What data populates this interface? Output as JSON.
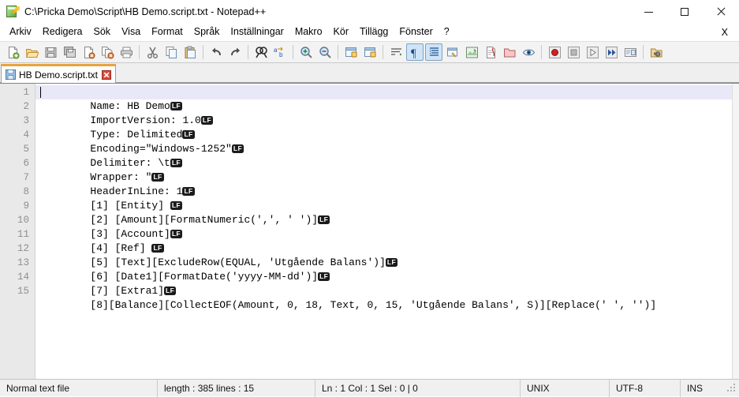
{
  "window": {
    "title": "C:\\Pricka Demo\\Script\\HB Demo.script.txt - Notepad++",
    "icon": "notepad-plus-plus-icon",
    "minimize_label": "",
    "maximize_label": "",
    "close_label": ""
  },
  "menubar": {
    "items": [
      {
        "label": "Arkiv"
      },
      {
        "label": "Redigera"
      },
      {
        "label": "Sök"
      },
      {
        "label": "Visa"
      },
      {
        "label": "Format"
      },
      {
        "label": "Språk"
      },
      {
        "label": "Inställningar"
      },
      {
        "label": "Makro"
      },
      {
        "label": "Kör"
      },
      {
        "label": "Tillägg"
      },
      {
        "label": "Fönster"
      },
      {
        "label": "?"
      }
    ],
    "close_document_label": "X"
  },
  "toolbar": {
    "buttons": [
      {
        "name": "new-file-icon",
        "title": "Nytt"
      },
      {
        "name": "open-file-icon",
        "title": "Öppna"
      },
      {
        "name": "save-icon",
        "title": "Spara"
      },
      {
        "name": "save-all-icon",
        "title": "Spara alla"
      },
      {
        "name": "close-file-icon",
        "title": "Stäng"
      },
      {
        "name": "close-all-files-icon",
        "title": "Stäng alla"
      },
      {
        "name": "print-icon",
        "title": "Skriv ut"
      },
      {
        "name": "separator-1",
        "title": ""
      },
      {
        "name": "cut-icon",
        "title": "Klipp ut"
      },
      {
        "name": "copy-icon",
        "title": "Kopiera"
      },
      {
        "name": "paste-icon",
        "title": "Klistra in"
      },
      {
        "name": "separator-2",
        "title": ""
      },
      {
        "name": "undo-icon",
        "title": "Ångra"
      },
      {
        "name": "redo-icon",
        "title": "Gör om"
      },
      {
        "name": "separator-3",
        "title": ""
      },
      {
        "name": "find-icon",
        "title": "Sök"
      },
      {
        "name": "replace-icon",
        "title": "Ersätt"
      },
      {
        "name": "separator-4",
        "title": ""
      },
      {
        "name": "zoom-in-icon",
        "title": "Zooma in"
      },
      {
        "name": "zoom-out-icon",
        "title": "Zooma ut"
      },
      {
        "name": "separator-5",
        "title": ""
      },
      {
        "name": "sync-vertical-scroll-icon",
        "title": "Synkronisera vertikal rullning"
      },
      {
        "name": "sync-horizontal-scroll-icon",
        "title": "Synkronisera horisontell rullning"
      },
      {
        "name": "separator-6",
        "title": ""
      },
      {
        "name": "word-wrap-icon",
        "title": "Radbrytning"
      },
      {
        "name": "show-all-characters-icon",
        "title": "Visa alla tecken",
        "active": true
      },
      {
        "name": "indent-guide-icon",
        "title": "Indenteringsguide",
        "active": true
      },
      {
        "name": "user-defined-dialog-icon",
        "title": "Användardefinierad dialog"
      },
      {
        "name": "document-map-icon",
        "title": "Dokumentkarta"
      },
      {
        "name": "function-list-icon",
        "title": "Funktionslista"
      },
      {
        "name": "folder-workspace-icon",
        "title": "Mapp som arbetsyta"
      },
      {
        "name": "monitoring-icon",
        "title": "Övervaka"
      },
      {
        "name": "separator-7",
        "title": ""
      },
      {
        "name": "record-macro-icon",
        "title": "Spela in makro"
      },
      {
        "name": "stop-macro-icon",
        "title": "Stoppa inspelning"
      },
      {
        "name": "play-macro-icon",
        "title": "Spela upp"
      },
      {
        "name": "run-macro-multiple-icon",
        "title": "Kör makro flera gånger"
      },
      {
        "name": "save-macro-icon",
        "title": "Spara inspelat makro"
      },
      {
        "name": "separator-8",
        "title": ""
      },
      {
        "name": "run-icon",
        "title": "Kör"
      }
    ]
  },
  "tabs": [
    {
      "label": "HB Demo.script.txt",
      "icon": "saved-floppy-icon",
      "close_icon": "tab-close-icon",
      "active": true
    }
  ],
  "editor": {
    "caret_line": 1,
    "eol_marker": "LF",
    "lines": [
      {
        "number": "1",
        "text": "Name: HB Demo",
        "eol": true
      },
      {
        "number": "2",
        "text": "ImportVersion: 1.0",
        "eol": true
      },
      {
        "number": "3",
        "text": "Type: Delimited",
        "eol": true
      },
      {
        "number": "4",
        "text": "Encoding=\"Windows-1252\"",
        "eol": true
      },
      {
        "number": "5",
        "text": "Delimiter: \\t",
        "eol": true
      },
      {
        "number": "6",
        "text": "Wrapper: \"",
        "eol": true
      },
      {
        "number": "7",
        "text": "HeaderInLine: 1",
        "eol": true
      },
      {
        "number": "8",
        "text": "[1] [Entity] ",
        "eol": true
      },
      {
        "number": "9",
        "text": "[2] [Amount][FormatNumeric(',', ' ')]",
        "eol": true
      },
      {
        "number": "10",
        "text": "[3] [Account]",
        "eol": true
      },
      {
        "number": "11",
        "text": "[4] [Ref] ",
        "eol": true
      },
      {
        "number": "12",
        "text": "[5] [Text][ExcludeRow(EQUAL, 'Utgående Balans')]",
        "eol": true
      },
      {
        "number": "13",
        "text": "[6] [Date1][FormatDate('yyyy-MM-dd')]",
        "eol": true
      },
      {
        "number": "14",
        "text": "[7] [Extra1]",
        "eol": true
      },
      {
        "number": "15",
        "text": "[8][Balance][CollectEOF(Amount, 0, 18, Text, 0, 15, 'Utgående Balans', S)][Replace(' ', '')]",
        "eol": false
      }
    ]
  },
  "statusbar": {
    "file_type": "Normal text file",
    "length_lines": "length : 385   lines : 15",
    "position": "Ln : 1    Col : 1    Sel : 0 | 0",
    "line_ending": "UNIX",
    "encoding": "UTF-8",
    "insert_mode": "INS"
  },
  "colors": {
    "tab_accent": "#e8a33d",
    "current_line_highlight": "#e8e8f8",
    "gutter_bg": "#e9e9e9",
    "toolbar_active": "#cfe4f7"
  }
}
